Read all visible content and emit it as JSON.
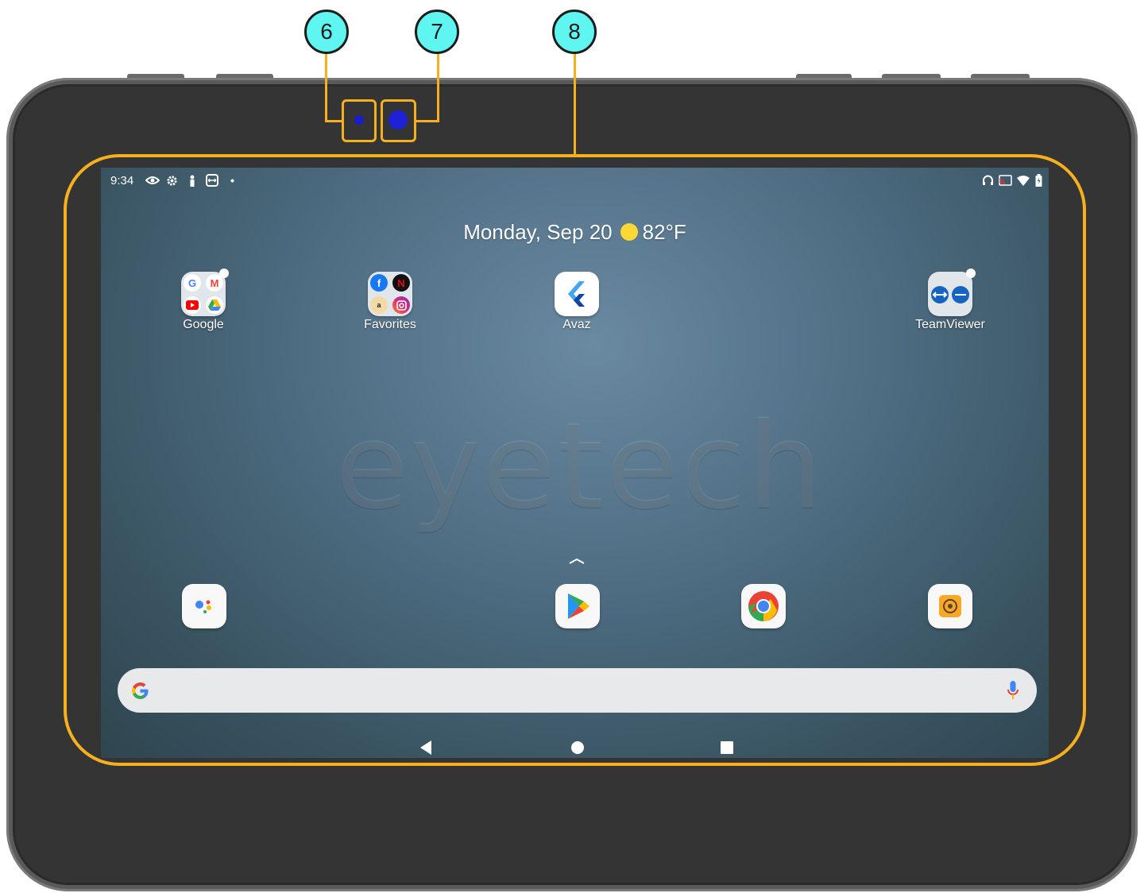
{
  "callouts": {
    "c6": "6",
    "c7": "7",
    "c8": "8"
  },
  "status_bar": {
    "time": "9:34"
  },
  "home": {
    "date": "Monday, Sep 20",
    "temperature": "82°F",
    "watermark": "eyetech",
    "apps": [
      {
        "label": "Google"
      },
      {
        "label": "Favorites"
      },
      {
        "label": "Avaz"
      },
      {
        "label": "TeamViewer"
      }
    ]
  },
  "dock": [
    "assistant-icon",
    "play-store-icon",
    "chrome-icon",
    "camera-app-icon"
  ],
  "colors": {
    "callout": "#5ff5f0",
    "highlight": "#f6b01e",
    "bezel": "#343434"
  }
}
